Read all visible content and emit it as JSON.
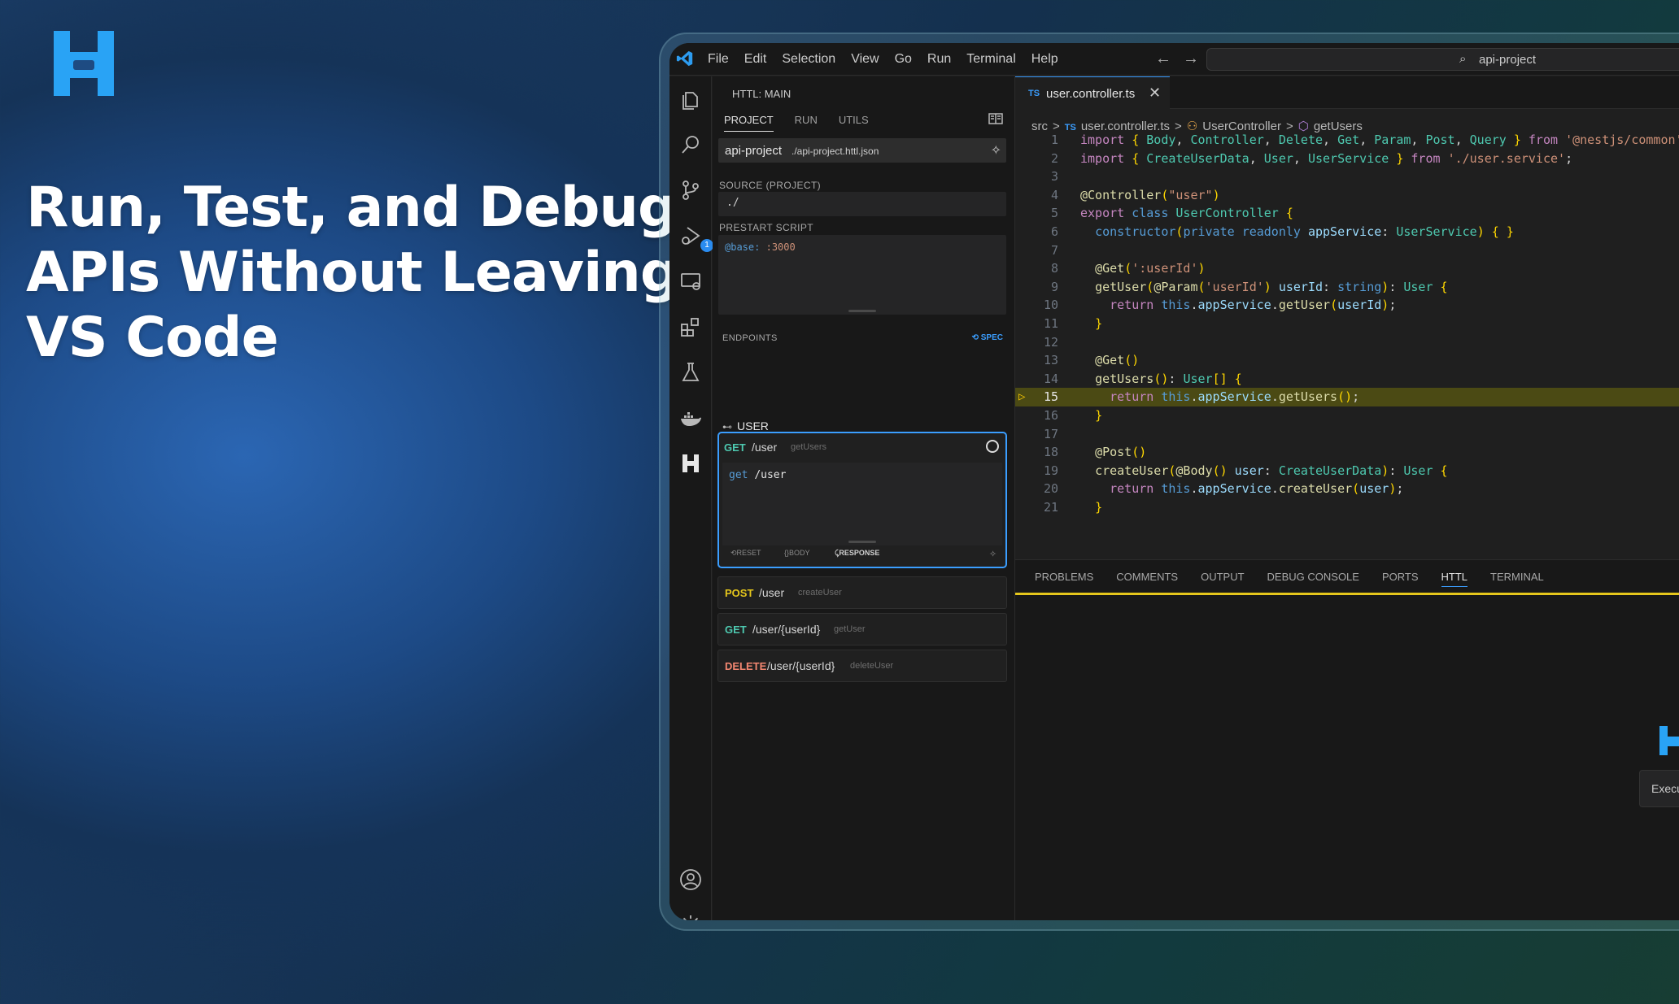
{
  "headline": [
    "Run, Test, and Debug",
    "APIs Without Leaving",
    "VS Code"
  ],
  "colors": {
    "brand": "#29a3f5",
    "accent": "#3b9eff",
    "highlight": "#4b4a14"
  },
  "titlebar": {
    "menu": [
      "File",
      "Edit",
      "Selection",
      "View",
      "Go",
      "Run",
      "Terminal",
      "Help"
    ],
    "search": "api-project"
  },
  "activity": {
    "icons": [
      "explorer-icon",
      "search-icon",
      "source-control-icon",
      "run-debug-icon",
      "remote-explorer-icon",
      "extensions-icon",
      "testing-icon",
      "docker-icon",
      "httl-icon",
      "account-icon",
      "settings-icon"
    ],
    "debug_badge": "1"
  },
  "sidebar": {
    "title": "HTTL: MAIN",
    "tabs": [
      "PROJECT",
      "RUN",
      "UTILS"
    ],
    "project": {
      "name": "api-project",
      "path": "./api-project.httl.json"
    },
    "source_label": "SOURCE (PROJECT)",
    "source_value": "./",
    "prestart_label": "PRESTART SCRIPT",
    "prestart_key": "@base:",
    "prestart_val": ":3000",
    "endpoints_label": "ENDPOINTS",
    "spec_label": "SPEC",
    "group": "USER",
    "active": {
      "method": "GET",
      "path": "/user",
      "fn": "getUsers",
      "req_kw": "get",
      "req_path": "/user",
      "footer": [
        "RESET",
        "BODY",
        "RESPONSE"
      ]
    },
    "endpoints": [
      {
        "method": "POST",
        "path": "/user",
        "fn": "createUser",
        "color": "#e5c61c"
      },
      {
        "method": "GET",
        "path": "/user/{userId}",
        "fn": "getUser",
        "color": "#4ec9b0"
      },
      {
        "method": "DELETE",
        "path": "/user/{userId}",
        "fn": "deleteUser",
        "color": "#f48771"
      }
    ]
  },
  "editor": {
    "tab": "user.controller.ts",
    "tab_lang": "TS",
    "breadcrumb": [
      "src",
      ">",
      "TS",
      "user.controller.ts",
      ">",
      "UserController",
      ">",
      "getUsers"
    ],
    "code": [
      "import { Body, Controller, Delete, Get, Param, Post, Query } from '@nestjs/common';",
      "import { CreateUserData, User, UserService } from './user.service';",
      "",
      "@Controller(\"user\")",
      "export class UserController {",
      "  constructor(private readonly appService: UserService) { }",
      "",
      "  @Get(':userId')",
      "  getUser(@Param('userId') userId: string): User {",
      "    return this.appService.getUser(userId);",
      "  }",
      "",
      "  @Get()",
      "  getUsers(): User[] {",
      "    return this.appService.getUsers();",
      "  }",
      "",
      "  @Post()",
      "  createUser(@Body() user: CreateUserData): User {",
      "    return this.appService.createUser(user);",
      "  }"
    ],
    "current_line": 15
  },
  "panel": {
    "tabs": [
      "PROBLEMS",
      "COMMENTS",
      "OUTPUT",
      "DEBUG CONSOLE",
      "PORTS",
      "HTTL",
      "TERMINAL"
    ],
    "active_tab": "HTTL",
    "toast": "Executing requ"
  }
}
